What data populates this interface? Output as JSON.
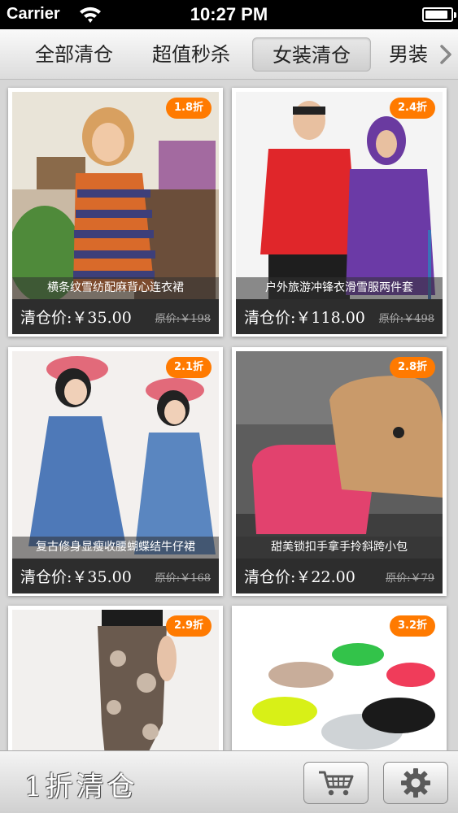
{
  "status_bar": {
    "carrier": "Carrier",
    "time": "10:27 PM",
    "battery_level": 0.9
  },
  "tabs": [
    {
      "label": "全部清仓",
      "active": false
    },
    {
      "label": "超值秒杀",
      "active": false
    },
    {
      "label": "女装清仓",
      "active": true
    },
    {
      "label": "男装",
      "active": false
    }
  ],
  "products": [
    {
      "discount": "1.8折",
      "title": "横条纹雪纺配麻背心连衣裙",
      "price": "清仓价:￥35.00",
      "original": "原价:￥198",
      "image": "woman-striped-dress-photo"
    },
    {
      "discount": "2.4折",
      "title": "户外旅游冲锋衣滑雪服两件套",
      "price": "清仓价:￥118.00",
      "original": "原价:￥498",
      "image": "outdoor-jackets-photo"
    },
    {
      "discount": "2.1折",
      "title": "复古修身显瘦收腰蝴蝶结牛仔裙",
      "price": "清仓价:￥35.00",
      "original": "原价:￥168",
      "image": "denim-dress-photo"
    },
    {
      "discount": "2.8折",
      "title": "甜美锁扣手拿手拎斜跨小包",
      "price": "清仓价:￥22.00",
      "original": "原价:￥79",
      "image": "handbags-photo"
    },
    {
      "discount": "2.9折",
      "image": "leggings-photo"
    },
    {
      "discount": "3.2折",
      "image": "sandals-photo"
    }
  ],
  "toolbar": {
    "title": "1折清仓"
  },
  "colors": {
    "badge": "#ff7a00",
    "price_bar": "#2d2d2d"
  }
}
